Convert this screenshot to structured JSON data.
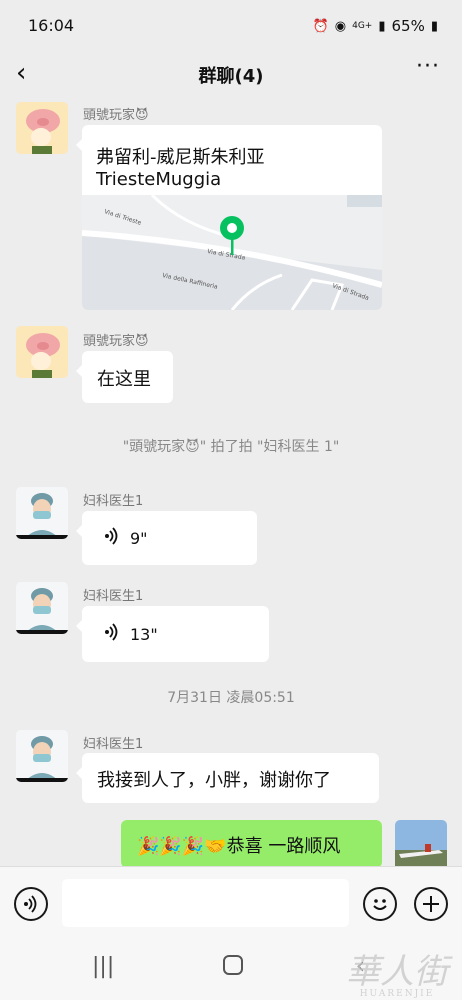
{
  "status": {
    "time": "16:04",
    "battery": "65%",
    "network": "4G+"
  },
  "header": {
    "title": "群聊(4)"
  },
  "messages": {
    "m1": {
      "sender": "頭號玩家😈",
      "line1": "弗留利-威尼斯朱利亚",
      "line2": "TriesteMuggia"
    },
    "m2": {
      "sender": "頭號玩家😈",
      "text": "在这里"
    },
    "sys1": "\"頭號玩家😈\" 拍了拍 \"妇科医生 1\"",
    "m3": {
      "sender": "妇科医生1",
      "duration": "9\""
    },
    "m4": {
      "sender": "妇科医生1",
      "duration": "13\""
    },
    "time1": "7月31日 凌晨05:51",
    "m5": {
      "sender": "妇科医生1",
      "text": "我接到人了，小胖，谢谢你了"
    },
    "m6": {
      "text": "🎉🎉🎉🤝恭喜 一路顺风"
    }
  },
  "map_labels": {
    "road1": "Via di Strada",
    "road2": "Via della Raffineria",
    "road3": "Via di Trieste",
    "road4": "Via di Strada"
  },
  "watermark": {
    "main": "華人街",
    "sub": "HUARENJIE"
  },
  "colors": {
    "bg": "#ededed",
    "own_bubble": "#95ec69",
    "pin": "#07c160"
  }
}
